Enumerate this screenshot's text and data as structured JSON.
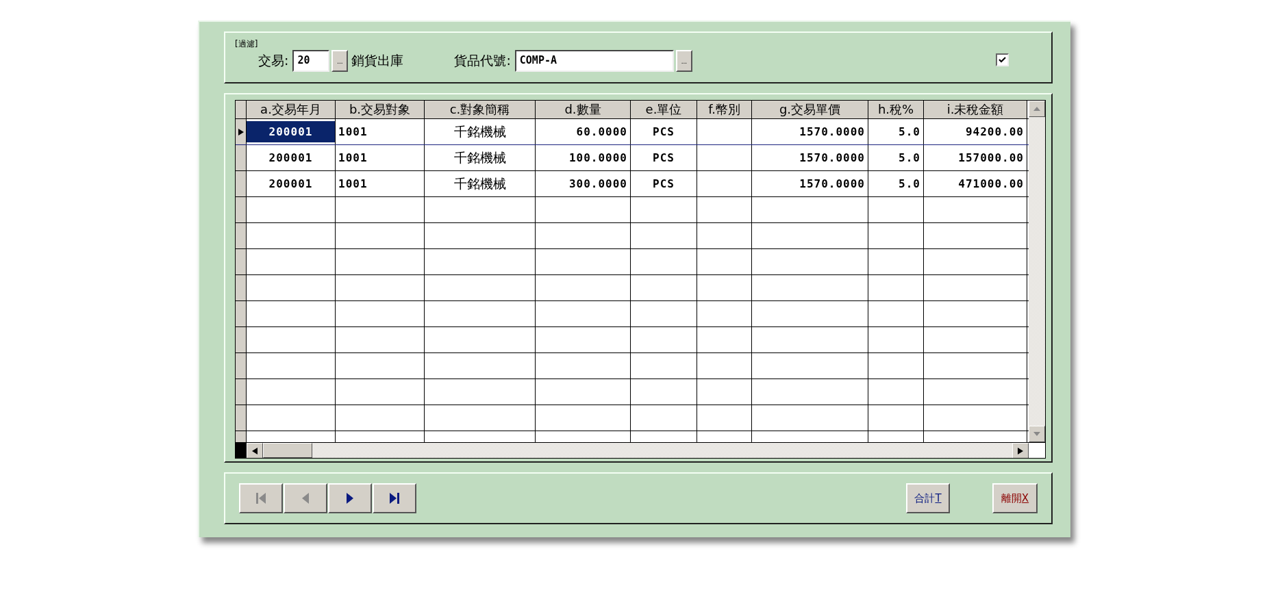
{
  "filter": {
    "caption": "[過濾]",
    "transaction_label": "交易:",
    "transaction_value": "20",
    "transaction_button": "...",
    "transaction_name": "銷貨出庫",
    "item_label": "貨品代號:",
    "item_value": "COMP-A",
    "item_button": "...",
    "checkbox_checked": true
  },
  "table": {
    "columns": [
      {
        "label": "a.交易年月"
      },
      {
        "label": "b.交易對象"
      },
      {
        "label": "c.對象簡稱"
      },
      {
        "label": "d.數量"
      },
      {
        "label": "e.單位"
      },
      {
        "label": "f.幣別"
      },
      {
        "label": "g.交易單價"
      },
      {
        "label": "h.稅%"
      },
      {
        "label": "i.未稅金額"
      }
    ],
    "rows": [
      {
        "selected": true,
        "cells": [
          "200001",
          "1001",
          "千銘機械",
          "60.0000",
          "PCS",
          "",
          "1570.0000",
          "5.0",
          "94200.00"
        ]
      },
      {
        "selected": false,
        "cells": [
          "200001",
          "1001",
          "千銘機械",
          "100.0000",
          "PCS",
          "",
          "1570.0000",
          "5.0",
          "157000.00"
        ]
      },
      {
        "selected": false,
        "cells": [
          "200001",
          "1001",
          "千銘機械",
          "300.0000",
          "PCS",
          "",
          "1570.0000",
          "5.0",
          "471000.00"
        ]
      }
    ]
  },
  "navigation": [
    {
      "kind": "first",
      "disabled": true
    },
    {
      "kind": "prev",
      "disabled": true
    },
    {
      "kind": "next",
      "disabled": false
    },
    {
      "kind": "last",
      "disabled": false
    }
  ],
  "buttons": [
    {
      "label": "合計",
      "hotkey": "T",
      "kind": "total"
    },
    {
      "label": "離開",
      "hotkey": "X",
      "kind": "exit"
    }
  ]
}
